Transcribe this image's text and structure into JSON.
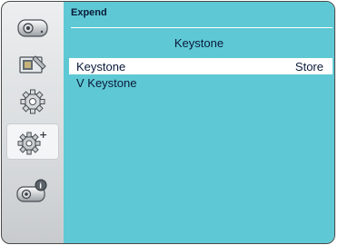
{
  "menu": {
    "header": "Expend",
    "title": "Keystone",
    "items": [
      {
        "label": "Keystone",
        "value": "Store",
        "selected": true
      },
      {
        "label": "V Keystone",
        "value": "",
        "selected": false
      }
    ]
  },
  "sidebar": {
    "items": [
      {
        "icon": "projector-icon",
        "selected": false
      },
      {
        "icon": "image-settings-icon",
        "selected": false
      },
      {
        "icon": "setting-gear-icon",
        "selected": false
      },
      {
        "icon": "expand-gear-icon",
        "selected": true
      },
      {
        "icon": "info-projector-icon",
        "selected": false
      }
    ]
  },
  "colors": {
    "panel": "#5ec9d4",
    "selected_row": "#ffffff",
    "text": "#0a1a3a"
  }
}
